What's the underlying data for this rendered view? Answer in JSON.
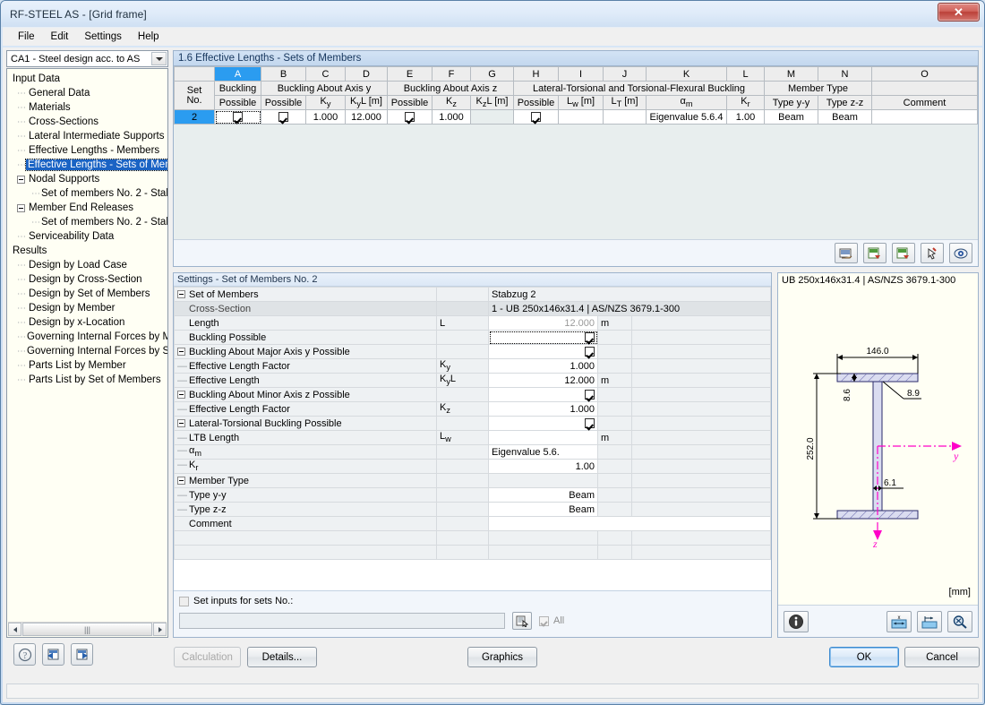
{
  "window": {
    "title": "RF-STEEL AS - [Grid frame]",
    "close_label": "✕"
  },
  "menubar": {
    "items": [
      "File",
      "Edit",
      "Settings",
      "Help"
    ]
  },
  "sidebar": {
    "combo_value": "CA1 - Steel design acc. to AS",
    "tree": [
      {
        "label": "Input Data",
        "indent": 0,
        "kind": "root"
      },
      {
        "label": "General Data",
        "indent": 1,
        "kind": "leaf"
      },
      {
        "label": "Materials",
        "indent": 1,
        "kind": "leaf"
      },
      {
        "label": "Cross-Sections",
        "indent": 1,
        "kind": "leaf"
      },
      {
        "label": "Lateral Intermediate Supports",
        "indent": 1,
        "kind": "leaf"
      },
      {
        "label": "Effective Lengths - Members",
        "indent": 1,
        "kind": "leaf"
      },
      {
        "label": "Effective Lengths - Sets of Mem",
        "indent": 1,
        "kind": "leaf",
        "selected": true
      },
      {
        "label": "Nodal Supports",
        "indent": 1,
        "kind": "expander"
      },
      {
        "label": "Set of members No. 2 - Stab",
        "indent": 2,
        "kind": "leaf"
      },
      {
        "label": "Member End Releases",
        "indent": 1,
        "kind": "expander"
      },
      {
        "label": "Set of members No. 2 - Stab",
        "indent": 2,
        "kind": "leaf"
      },
      {
        "label": "Serviceability Data",
        "indent": 1,
        "kind": "leaf"
      },
      {
        "label": "Results",
        "indent": 0,
        "kind": "root"
      },
      {
        "label": "Design by Load Case",
        "indent": 1,
        "kind": "leaf"
      },
      {
        "label": "Design by Cross-Section",
        "indent": 1,
        "kind": "leaf"
      },
      {
        "label": "Design by Set of Members",
        "indent": 1,
        "kind": "leaf"
      },
      {
        "label": "Design by Member",
        "indent": 1,
        "kind": "leaf"
      },
      {
        "label": "Design by x-Location",
        "indent": 1,
        "kind": "leaf"
      },
      {
        "label": "Governing Internal Forces by M",
        "indent": 1,
        "kind": "leaf"
      },
      {
        "label": "Governing Internal Forces by S",
        "indent": 1,
        "kind": "leaf"
      },
      {
        "label": "Parts List by Member",
        "indent": 1,
        "kind": "leaf"
      },
      {
        "label": "Parts List by Set of Members",
        "indent": 1,
        "kind": "leaf"
      }
    ]
  },
  "section": {
    "header": "1.6 Effective Lengths - Sets of Members"
  },
  "table": {
    "column_letters": [
      "A",
      "B",
      "C",
      "D",
      "E",
      "F",
      "G",
      "H",
      "I",
      "J",
      "K",
      "L",
      "M",
      "N",
      "O"
    ],
    "active_column": "A",
    "group_headers": [
      {
        "label": "",
        "span": 1
      },
      {
        "label": "Buckling",
        "span": 1
      },
      {
        "label": "Buckling About Axis y",
        "span": 3
      },
      {
        "label": "Buckling About Axis z",
        "span": 3
      },
      {
        "label": "Lateral-Torsional and Torsional-Flexural Buckling",
        "span": 5
      },
      {
        "label": "Member Type",
        "span": 2
      },
      {
        "label": "",
        "span": 1
      }
    ],
    "sub_headers": [
      "Set\nNo.",
      "Possible",
      "Possible",
      "Ky",
      "KyL [m]",
      "Possible",
      "Kz",
      "KzL [m]",
      "Possible",
      "Lw [m]",
      "LT [m]",
      "αm",
      "Kr",
      "Type y-y",
      "Type z-z",
      "Comment"
    ],
    "sub_headers_flat": [
      "Possible",
      "Possible",
      "Ky",
      "KyL [m]",
      "Possible",
      "Kz",
      "KzL [m]",
      "Possible",
      "Lw [m]",
      "LT [m]",
      "αm",
      "Kr",
      "Type y-y",
      "Type z-z",
      "Comment"
    ],
    "row_header_left": "Set",
    "row_header_left2": "No.",
    "rows": [
      {
        "set_no": "2",
        "buckling_possible": true,
        "y_possible": true,
        "Ky": "1.000",
        "KyL": "12.000",
        "z_possible": true,
        "Kz": "1.000",
        "KzL": "",
        "ltb_possible": true,
        "Lw": "",
        "LT": "",
        "alpha_m": "Eigenvalue 5.6.4",
        "Kr": "1.00",
        "type_yy": "Beam",
        "type_zz": "Beam",
        "comment": ""
      }
    ],
    "toolbar_icons": [
      "print-preview-icon",
      "export-excel-up-icon",
      "export-excel-down-icon",
      "pick-icon",
      "view-eye-icon"
    ]
  },
  "settings": {
    "header": "Settings - Set of Members No. 2",
    "rows": [
      {
        "name": "Set of Members",
        "marker": "expander",
        "sym": "",
        "val": "Stabzug 2",
        "unit": "",
        "style": "name-value"
      },
      {
        "name": "Cross-Section",
        "marker": "none",
        "sym": "",
        "val": "1 - UB 250x146x31.4 | AS/NZS 3679.1-300",
        "unit": "",
        "style": "cross-section"
      },
      {
        "name": "Length",
        "marker": "none",
        "sym": "L",
        "val": "12.000",
        "unit": "m",
        "style": "readonly"
      },
      {
        "name": "Buckling Possible",
        "marker": "none",
        "sym": "",
        "val": "",
        "unit": "",
        "style": "checkbox-focused",
        "checked": true
      },
      {
        "name": "Buckling About Major Axis y Possible",
        "marker": "expander",
        "sym": "",
        "val": "",
        "unit": "",
        "style": "checkbox",
        "checked": true
      },
      {
        "name": "Effective Length Factor",
        "marker": "dash",
        "sym": "Ky",
        "val": "1.000",
        "unit": "",
        "style": "value"
      },
      {
        "name": "Effective Length",
        "marker": "dash",
        "sym": "KyL",
        "val": "12.000",
        "unit": "m",
        "style": "value"
      },
      {
        "name": "Buckling About Minor Axis z Possible",
        "marker": "expander",
        "sym": "",
        "val": "",
        "unit": "",
        "style": "checkbox",
        "checked": true
      },
      {
        "name": "Effective Length Factor",
        "marker": "dash",
        "sym": "Kz",
        "val": "1.000",
        "unit": "",
        "style": "value"
      },
      {
        "name": "Lateral-Torsional Buckling Possible",
        "marker": "expander",
        "sym": "",
        "val": "",
        "unit": "",
        "style": "checkbox",
        "checked": true
      },
      {
        "name": "LTB Length",
        "marker": "dash",
        "sym": "Lw",
        "val": "",
        "unit": "m",
        "style": "value"
      },
      {
        "name": "αm",
        "marker": "dash",
        "sym": "",
        "val": "Eigenvalue 5.6.",
        "unit": "",
        "style": "value-left"
      },
      {
        "name": "Kr",
        "marker": "dash",
        "sym": "",
        "val": "1.00",
        "unit": "",
        "style": "value"
      },
      {
        "name": "Member Type",
        "marker": "expander",
        "sym": "",
        "val": "",
        "unit": "",
        "style": "group"
      },
      {
        "name": "Type y-y",
        "marker": "dash",
        "sym": "",
        "val": "Beam",
        "unit": "",
        "style": "value"
      },
      {
        "name": "Type z-z",
        "marker": "dash",
        "sym": "",
        "val": "Beam",
        "unit": "",
        "style": "value"
      },
      {
        "name": "Comment",
        "marker": "none",
        "sym": "",
        "val": "",
        "unit": "",
        "style": "comment"
      },
      {
        "name": "",
        "marker": "none",
        "sym": "",
        "val": "",
        "unit": "",
        "style": "blank"
      },
      {
        "name": "",
        "marker": "none",
        "sym": "",
        "val": "",
        "unit": "",
        "style": "blank"
      }
    ],
    "set_inputs_label": "Set inputs for sets No.:",
    "set_inputs_value": "",
    "all_label": "All"
  },
  "cross_section": {
    "title": "UB 250x146x31.4 | AS/NZS 3679.1-300",
    "unit_label": "[mm]",
    "dims": {
      "width": "146.0",
      "height": "252.0",
      "flange_thickness": "8.6",
      "root_radius": "8.9",
      "web_thickness": "6.1"
    },
    "axis_y_label": "y",
    "axis_z_label": "z",
    "buttons": [
      "info-icon",
      "dimension-x-icon",
      "dimension-tab-icon",
      "zoom-reset-icon"
    ],
    "axis_color": "#ff00c8",
    "fill_color": "#dadcf0"
  },
  "bottom": {
    "icon_buttons": [
      "help-icon",
      "prev-page-icon",
      "next-page-icon"
    ],
    "calculation_label": "Calculation",
    "details_label": "Details...",
    "graphics_label": "Graphics",
    "ok_label": "OK",
    "cancel_label": "Cancel"
  }
}
